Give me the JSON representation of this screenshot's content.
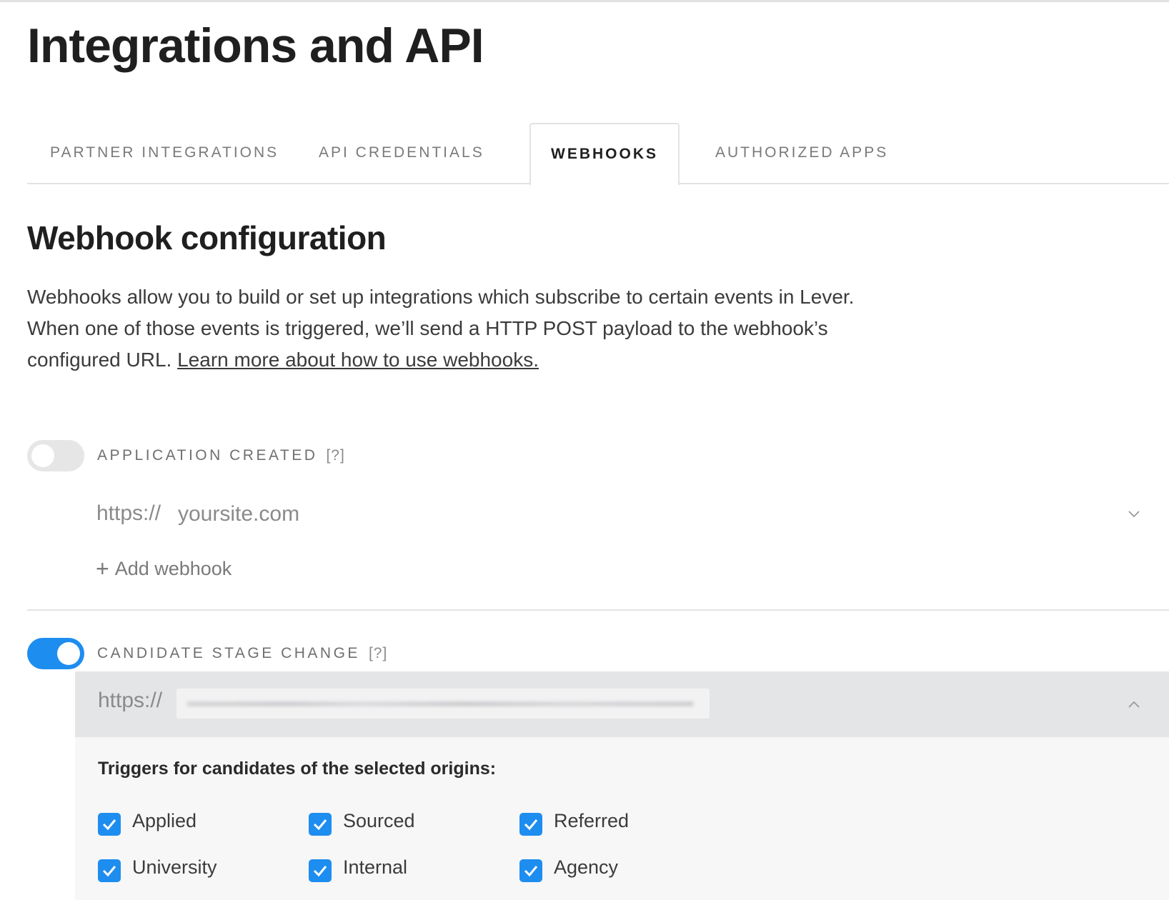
{
  "page": {
    "title": "Integrations and API"
  },
  "tabs": [
    {
      "label": "PARTNER INTEGRATIONS",
      "active": false
    },
    {
      "label": "API CREDENTIALS",
      "active": false
    },
    {
      "label": "WEBHOOKS",
      "active": true
    },
    {
      "label": "AUTHORIZED APPS",
      "active": false
    }
  ],
  "section": {
    "title": "Webhook configuration",
    "description": "Webhooks allow you to build or set up integrations which subscribe to certain events in Lever. When one of those events is triggered, we’ll send a HTTP POST payload to the webhook’s configured URL.",
    "learn_more_link": "Learn more about how to use webhooks."
  },
  "events": [
    {
      "label": "APPLICATION CREATED",
      "help": "[?]",
      "enabled": false,
      "url_prefix": "https://",
      "url_placeholder": "yoursite.com",
      "add_webhook_label": "Add webhook",
      "icons": {
        "expand": "chevron-down-icon",
        "add": "plus-icon"
      }
    },
    {
      "label": "CANDIDATE STAGE CHANGE",
      "help": "[?]",
      "enabled": true,
      "url_prefix": "https://",
      "url_value_redacted": true,
      "icons": {
        "collapse": "chevron-up-icon"
      },
      "triggers_label": "Triggers for candidates of the selected origins:",
      "origins": [
        {
          "label": "Applied",
          "checked": true
        },
        {
          "label": "Sourced",
          "checked": true
        },
        {
          "label": "Referred",
          "checked": true
        },
        {
          "label": "University",
          "checked": true
        },
        {
          "label": "Internal",
          "checked": true
        },
        {
          "label": "Agency",
          "checked": true
        }
      ]
    }
  ],
  "colors": {
    "accent": "#1e8df0",
    "toggle_off": "#e6e6e6",
    "panel_bg": "#f7f7f7",
    "url_bar_active_bg": "#e4e5e7"
  }
}
